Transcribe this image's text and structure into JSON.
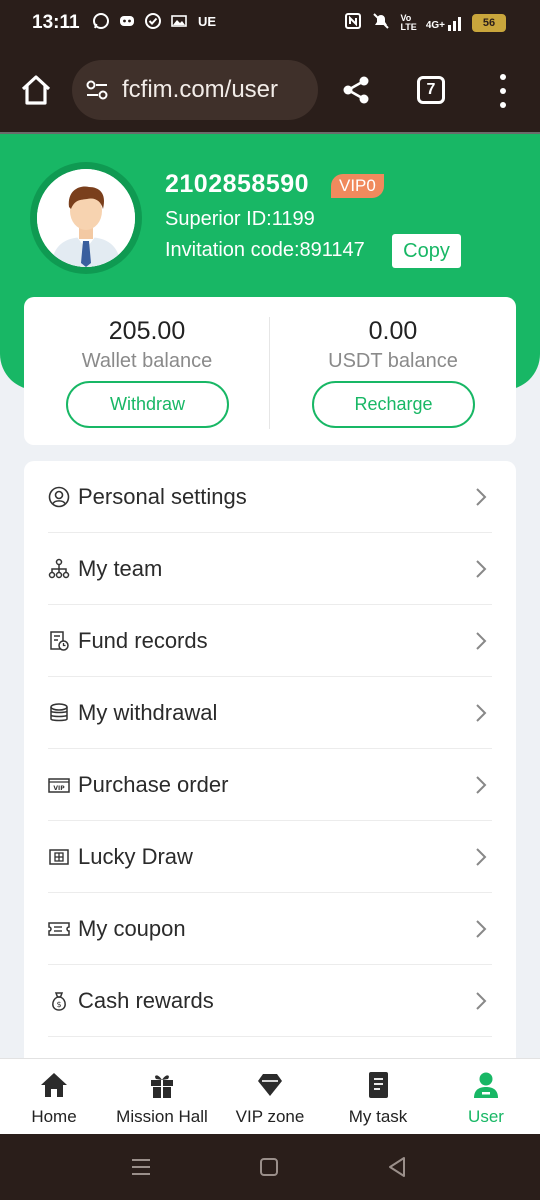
{
  "status_bar": {
    "time": "13:11",
    "carrier_text": "UE",
    "network_text": "4G+",
    "battery": "56"
  },
  "browser": {
    "url": "fcfim.com/user",
    "tab_count": "7"
  },
  "profile": {
    "user_id": "2102858590",
    "vip_level": "VIP0",
    "superior_id": "Superior ID:1199",
    "invitation_code": "Invitation code:891147",
    "copy_label": "Copy"
  },
  "balances": {
    "wallet_value": "205.00",
    "wallet_label": "Wallet balance",
    "withdraw_label": "Withdraw",
    "usdt_value": "0.00",
    "usdt_label": "USDT balance",
    "recharge_label": "Recharge"
  },
  "menu": {
    "items": [
      {
        "label": "Personal settings",
        "icon": "user-circle-icon"
      },
      {
        "label": "My team",
        "icon": "team-tree-icon"
      },
      {
        "label": "Fund records",
        "icon": "fund-records-icon"
      },
      {
        "label": "My withdrawal",
        "icon": "coins-stack-icon"
      },
      {
        "label": "Purchase order",
        "icon": "vip-ticket-icon"
      },
      {
        "label": "Lucky Draw",
        "icon": "lucky-draw-icon"
      },
      {
        "label": "My coupon",
        "icon": "coupon-icon"
      },
      {
        "label": "Cash rewards",
        "icon": "money-bag-icon"
      }
    ]
  },
  "bottom_nav": {
    "items": [
      {
        "label": "Home",
        "icon": "home-icon"
      },
      {
        "label": "Mission Hall",
        "icon": "gift-icon"
      },
      {
        "label": "VIP zone",
        "icon": "diamond-icon"
      },
      {
        "label": "My task",
        "icon": "notebook-icon"
      },
      {
        "label": "User",
        "icon": "user-icon"
      }
    ],
    "active": "User"
  },
  "colors": {
    "brand_green": "#18b765",
    "vip_badge": "#f08a5d",
    "browser_chrome": "#2a1e1a"
  }
}
